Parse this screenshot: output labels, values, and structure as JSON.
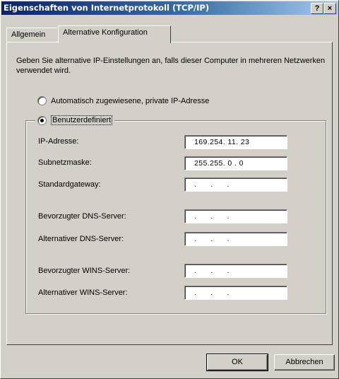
{
  "window": {
    "title": "Eigenschaften von Internetprotokoll (TCP/IP)",
    "help_button": "?",
    "close_button": "×"
  },
  "tabs": [
    {
      "label": "Allgemein"
    },
    {
      "label": "Alternative Konfiguration"
    }
  ],
  "description": "Geben Sie alternative IP-Einstellungen an, falls dieser Computer in mehreren Netzwerken verwendet wird.",
  "options": {
    "auto": {
      "label": "Automatisch zugewiesene, private IP-Adresse",
      "checked": false
    },
    "custom": {
      "label": "Benutzerdefiniert",
      "checked": true
    }
  },
  "fields": {
    "ip_address": {
      "label": "IP-Adresse:",
      "value": "169.254. 11. 23"
    },
    "subnet_mask": {
      "label": "Subnetzmaske:",
      "value": "255.255. 0 . 0"
    },
    "default_gateway": {
      "label": "Standardgateway:",
      "value": ".      .      ."
    },
    "preferred_dns": {
      "label": "Bevorzugter DNS-Server:",
      "value": ".      .      ."
    },
    "alternate_dns": {
      "label": "Alternativer DNS-Server:",
      "value": ".      .      ."
    },
    "preferred_wins": {
      "label": "Bevorzugter WINS-Server:",
      "value": ".      .      ."
    },
    "alternate_wins": {
      "label": "Alternativer WINS-Server:",
      "value": ".      .      ."
    }
  },
  "buttons": {
    "ok": "OK",
    "cancel": "Abbrechen"
  }
}
